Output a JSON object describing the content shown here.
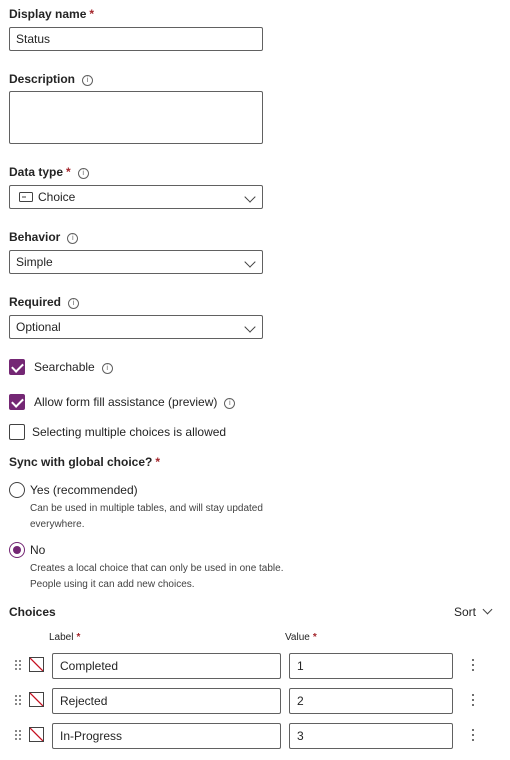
{
  "display_name": {
    "label": "Display name",
    "required": "*",
    "value": "Status"
  },
  "description": {
    "label": "Description",
    "value": ""
  },
  "data_type": {
    "label": "Data type",
    "required": "*",
    "value": "Choice"
  },
  "behavior": {
    "label": "Behavior",
    "value": "Simple"
  },
  "required_field": {
    "label": "Required",
    "value": "Optional"
  },
  "checkboxes": {
    "searchable": {
      "label": "Searchable",
      "checked": true
    },
    "form_fill": {
      "label": "Allow form fill assistance (preview)",
      "checked": true
    },
    "multiple": {
      "label": "Selecting multiple choices is allowed",
      "checked": false
    }
  },
  "sync": {
    "label": "Sync with global choice?",
    "required": "*",
    "yes": {
      "label": "Yes (recommended)",
      "hint": "Can be used in multiple tables, and will stay updated everywhere.",
      "selected": false
    },
    "no": {
      "label": "No",
      "hint": "Creates a local choice that can only be used in one table. People using it can add new choices.",
      "selected": true
    }
  },
  "choices": {
    "title": "Choices",
    "sort_label": "Sort",
    "label_header": "Label",
    "value_header": "Value",
    "required": "*",
    "rows": [
      {
        "label": "Completed",
        "value": "1"
      },
      {
        "label": "Rejected",
        "value": "2"
      },
      {
        "label": "In-Progress",
        "value": "3"
      }
    ]
  },
  "colors": {
    "accent": "#742774",
    "required": "#a4262c",
    "swatch_none": "#c50f1f"
  },
  "icons": {
    "info": "info-icon",
    "choice_type": "choice-type-icon",
    "chevron": "chevron-down-icon",
    "drag": "drag-handle-icon",
    "more": "more-vertical-icon",
    "color_none": "no-color-swatch"
  }
}
